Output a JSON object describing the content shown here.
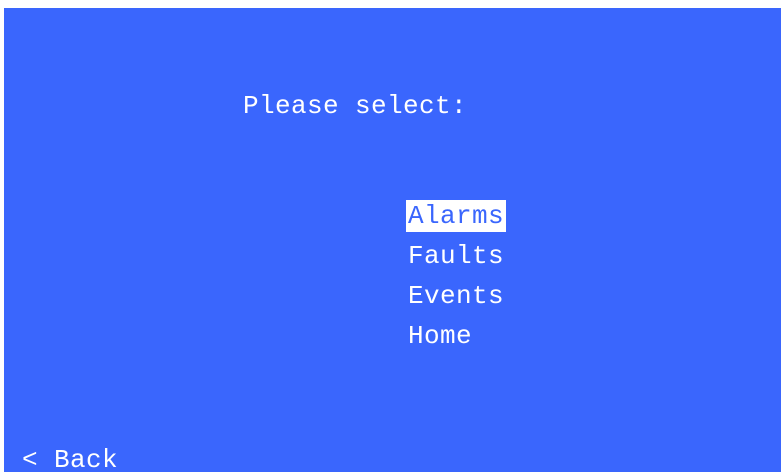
{
  "screen": {
    "background_color": "#3a66fd",
    "text_color": "#ffffff",
    "title": "Please select:",
    "menu": {
      "items": [
        {
          "label": "Alarms",
          "selected": true
        },
        {
          "label": "Faults",
          "selected": false
        },
        {
          "label": "Events",
          "selected": false
        },
        {
          "label": "Home",
          "selected": false
        }
      ]
    },
    "back_label": "< Back"
  }
}
